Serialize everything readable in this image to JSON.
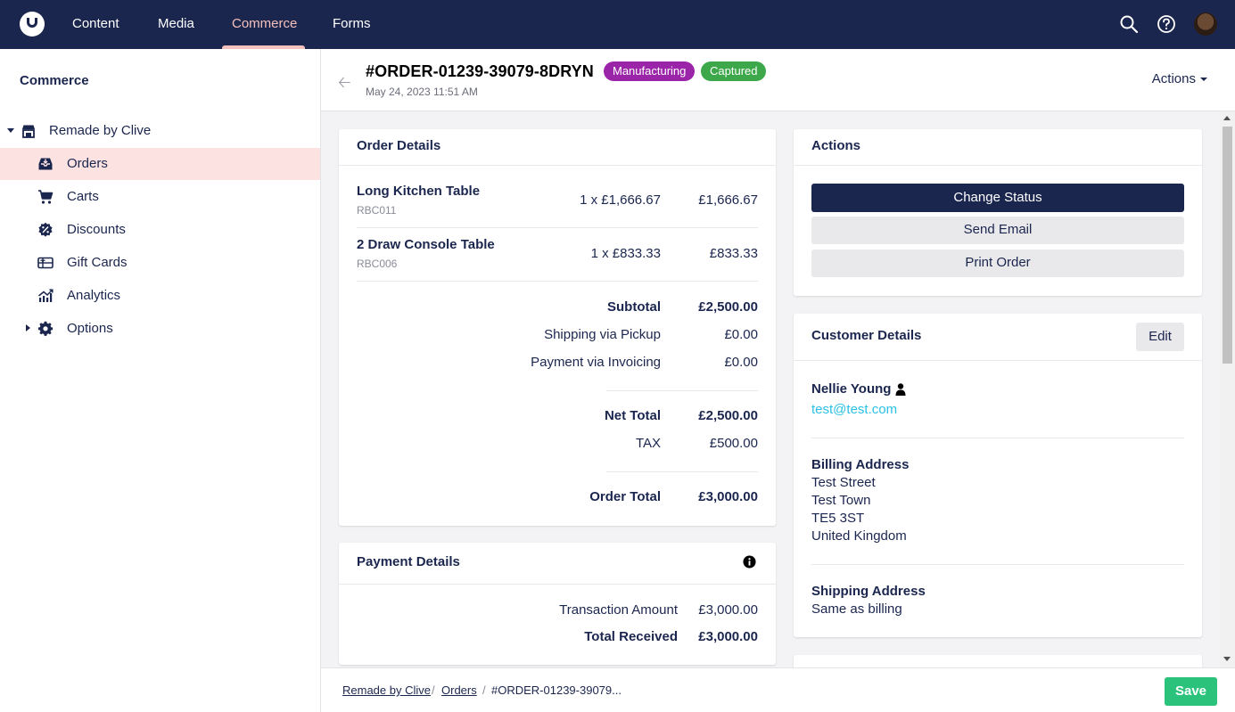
{
  "topnav": {
    "items": [
      {
        "label": "Content"
      },
      {
        "label": "Media"
      },
      {
        "label": "Commerce",
        "active": true
      },
      {
        "label": "Forms"
      }
    ],
    "icons": [
      "search-icon",
      "help-icon",
      "avatar"
    ]
  },
  "sidebar": {
    "title": "Commerce",
    "store": "Remade by Clive",
    "items": [
      {
        "label": "Orders",
        "icon": "orders-icon",
        "selected": true
      },
      {
        "label": "Carts",
        "icon": "cart-icon"
      },
      {
        "label": "Discounts",
        "icon": "discount-icon"
      },
      {
        "label": "Gift Cards",
        "icon": "gift-card-icon"
      },
      {
        "label": "Analytics",
        "icon": "analytics-icon"
      },
      {
        "label": "Options",
        "icon": "gear-icon"
      }
    ]
  },
  "header": {
    "order_number": "#ORDER-01239-39079-8DRYN",
    "badges": [
      {
        "label": "Manufacturing",
        "color": "#9a25a8"
      },
      {
        "label": "Captured",
        "color": "#3da84a"
      }
    ],
    "date": "May 24, 2023 11:51 AM",
    "actions_label": "Actions"
  },
  "order_details": {
    "title": "Order Details",
    "lines": [
      {
        "name": "Long Kitchen Table",
        "sku": "RBC011",
        "qty_price": "1 x £1,666.67",
        "total": "£1,666.67"
      },
      {
        "name": "2 Draw Console Table",
        "sku": "RBC006",
        "qty_price": "1 x £833.33",
        "total": "£833.33"
      }
    ],
    "subtotal_label": "Subtotal",
    "subtotal": "£2,500.00",
    "shipping_label": "Shipping via Pickup",
    "shipping": "£0.00",
    "payment_label": "Payment via Invoicing",
    "payment": "£0.00",
    "net_total_label": "Net Total",
    "net_total": "£2,500.00",
    "tax_label": "TAX",
    "tax": "£500.00",
    "order_total_label": "Order Total",
    "order_total": "£3,000.00"
  },
  "payment_details": {
    "title": "Payment Details",
    "transaction_label": "Transaction Amount",
    "transaction": "£3,000.00",
    "received_label": "Total Received",
    "received": "£3,000.00"
  },
  "actions_card": {
    "title": "Actions",
    "change_status": "Change Status",
    "send_email": "Send Email",
    "print_order": "Print Order"
  },
  "customer": {
    "title": "Customer Details",
    "edit_label": "Edit",
    "name": "Nellie Young",
    "email": "test@test.com",
    "billing_title": "Billing Address",
    "billing_lines": [
      "Test Street",
      "Test Town",
      "TE5 3ST",
      "United Kingdom"
    ],
    "shipping_title": "Shipping Address",
    "shipping_value": "Same as billing"
  },
  "footer": {
    "breadcrumb": [
      "Remade by Clive",
      "Orders"
    ],
    "current": "#ORDER-01239-39079...",
    "save_label": "Save"
  },
  "colors": {
    "navy": "#1b264f",
    "accent_pink": "#f5c1bc",
    "selected_bg": "#fce3e1",
    "link": "#2bc0e4",
    "save_green": "#2bc37c"
  }
}
